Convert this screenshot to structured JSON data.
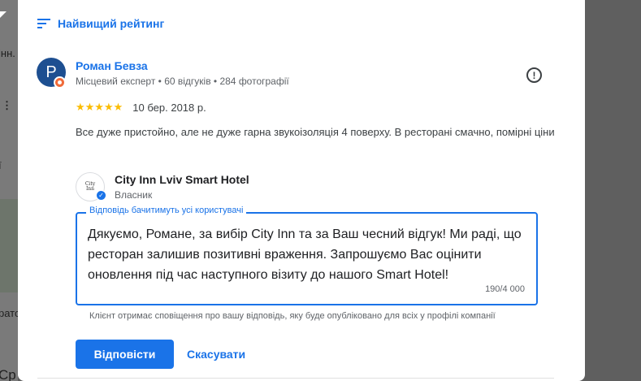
{
  "background": {
    "fragments": [
      "інн.",
      "⋮",
      "ї",
      "рато",
      "Ср"
    ]
  },
  "sort": {
    "label": "Найвищий рейтинг",
    "icon": "sort-icon"
  },
  "review": {
    "avatar_letter": "P",
    "reviewer_name": "Роман Бевза",
    "reviewer_meta": "Місцевий експерт • 60 відгуків • 284 фотографії",
    "rating": 5,
    "stars": "★★★★★",
    "date": "10 бер. 2018 р.",
    "text": "Все дуже пристойно, але не дуже гарна звукоізоляція 4 поверху. В ресторані смачно, помірні ціни",
    "report_icon": "report-icon"
  },
  "owner": {
    "logo_line1": "City",
    "logo_line2": "Inn",
    "name": "City Inn Lviv Smart Hotel",
    "role": "Власник"
  },
  "reply": {
    "legend": "Відповідь бачитимуть усі користувачі",
    "text": "Дякуємо, Романе, за вибір City Inn та за Ваш чесний відгук! Ми раді, що ресторан залишив позитивні враження. Запрошуємо Вас оцінити оновлення під час наступного візиту до нашого Smart Hotel!",
    "counter": "190/4 000",
    "notice": "Клієнт отримає сповіщення про вашу відповідь, яку буде опубліковано для всіх у профілі компанії"
  },
  "actions": {
    "reply_label": "Відповісти",
    "cancel_label": "Скасувати"
  },
  "colors": {
    "accent": "#1a73e8",
    "star": "#fbbc04",
    "avatar": "#1d4f91",
    "badge": "#f06b3a"
  }
}
